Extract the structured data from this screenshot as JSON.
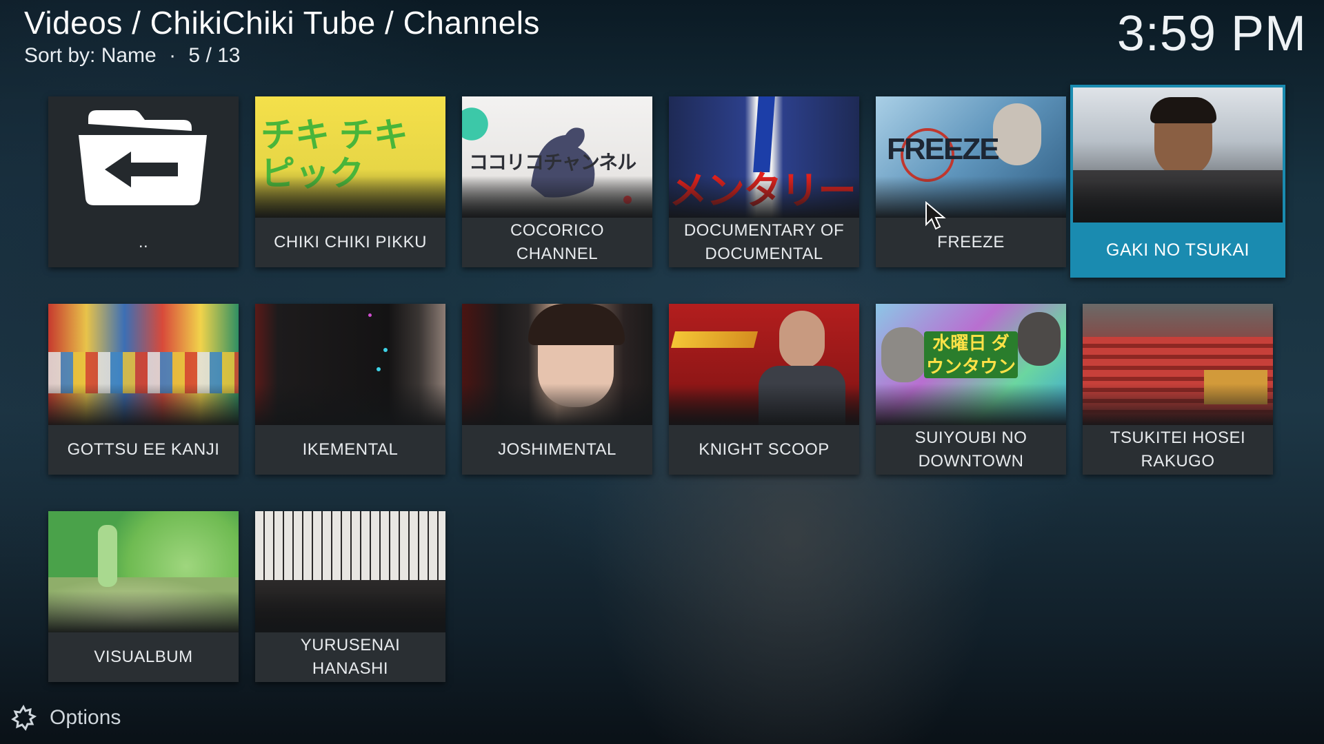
{
  "header": {
    "breadcrumb": "Videos / ChikiChiki Tube / Channels",
    "sort_label": "Sort by: Name",
    "separator": "·",
    "position": "5 / 13"
  },
  "clock": "3:59 PM",
  "footer": {
    "options_label": "Options"
  },
  "colors": {
    "focus": "#1a8bb0",
    "tile": "#2a2f33"
  },
  "tiles": [
    {
      "label": "..",
      "icon": "folder-back-icon"
    },
    {
      "label": "CHIKI CHIKI PIKKU",
      "thumb_text": "チキ チキ ピック"
    },
    {
      "label": "COCORICO CHANNEL",
      "thumb_text": "ココリコチャンネル"
    },
    {
      "label": "DOCUMENTARY OF DOCUMENTAL",
      "thumb_text": "メンタリー"
    },
    {
      "label": "FREEZE",
      "thumb_text": "FREEZE"
    },
    {
      "label": "GAKI NO TSUKAI",
      "focused": true
    },
    {
      "label": "GOTTSU EE KANJI"
    },
    {
      "label": "IKEMENTAL"
    },
    {
      "label": "JOSHIMENTAL"
    },
    {
      "label": "KNIGHT SCOOP"
    },
    {
      "label": "SUIYOUBI NO DOWNTOWN",
      "thumb_text": "水曜日 ダウンタウン"
    },
    {
      "label": "TSUKITEI HOSEI RAKUGO"
    },
    {
      "label": "VISUALBUM"
    },
    {
      "label": "YURUSENAI HANASHI"
    }
  ]
}
